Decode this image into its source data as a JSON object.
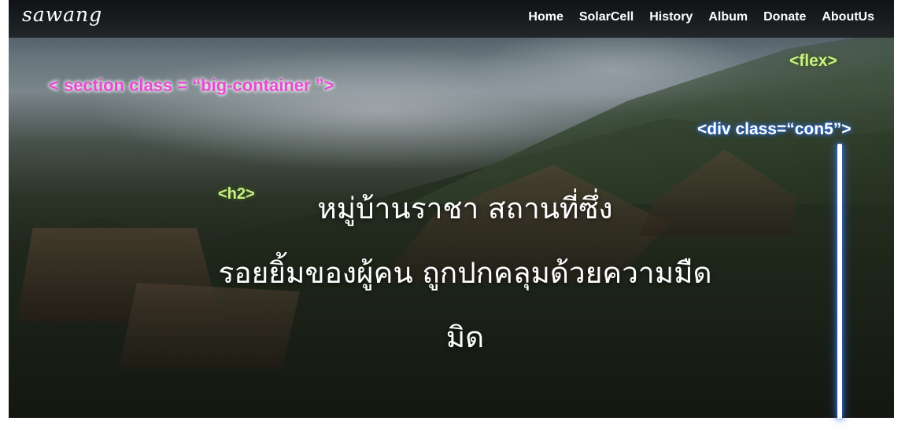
{
  "header": {
    "logo": "sawang",
    "nav": [
      "Home",
      "SolarCell",
      "History",
      "Album",
      "Donate",
      "AboutUs"
    ]
  },
  "hero": {
    "headline_line1": "หมู่บ้านราชา สถานที่ซึ่ง",
    "headline_line2": "รอยยิ้มของผู้คน ถูกปกคลุมด้วยความมืด",
    "headline_line3": "มิด"
  },
  "annotations": {
    "section": "< section class = “big-container ”>",
    "flex": "<flex>",
    "div": "<div class=“con5”>",
    "h2": "<h2>"
  },
  "colors": {
    "section_annotation": "#e64bd0",
    "green_annotation": "#c9ef8a",
    "blue_glow": "#3a78e6"
  }
}
